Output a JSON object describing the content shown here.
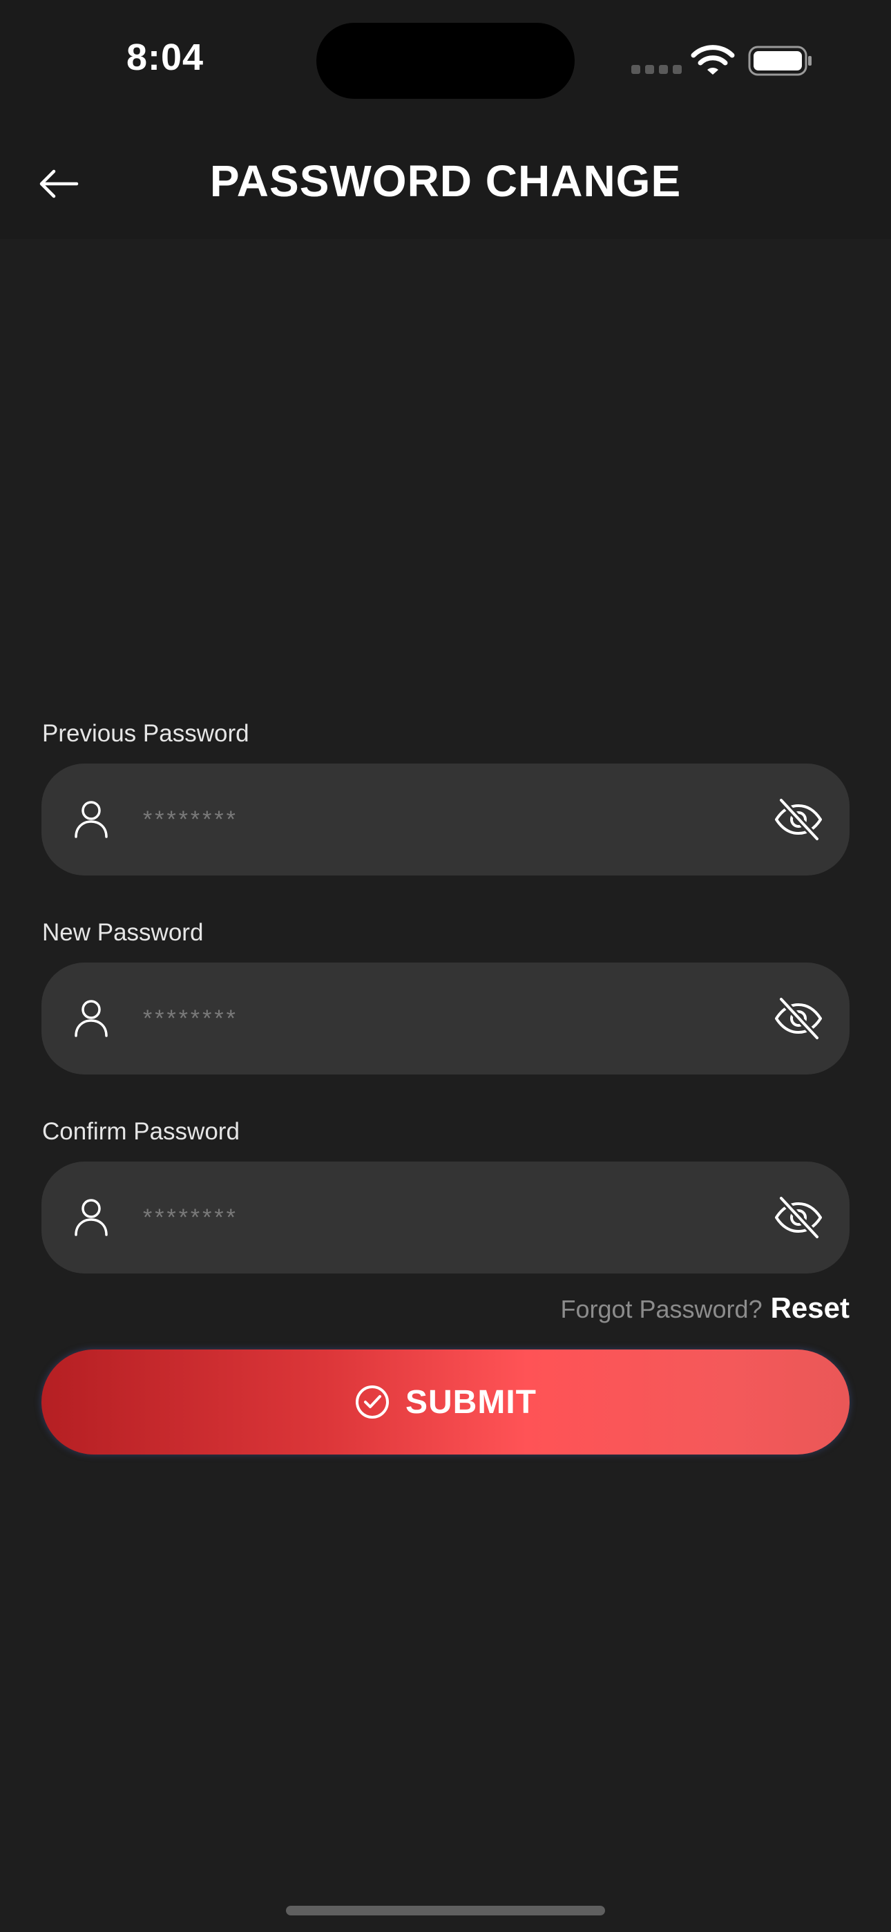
{
  "status_bar": {
    "time": "8:04"
  },
  "header": {
    "title": "PASSWORD CHANGE",
    "back_icon": "arrow-left-icon"
  },
  "form": {
    "fields": [
      {
        "label": "Previous Password",
        "placeholder": "********",
        "leading_icon": "user-icon",
        "trailing_icon": "eye-off-icon"
      },
      {
        "label": "New Password",
        "placeholder": "********",
        "leading_icon": "user-icon",
        "trailing_icon": "eye-off-icon"
      },
      {
        "label": "Confirm Password",
        "placeholder": "********",
        "leading_icon": "user-icon",
        "trailing_icon": "eye-off-icon"
      }
    ],
    "forgot_text": "Forgot Password?",
    "reset_label": "Reset",
    "submit_label": "SUBMIT",
    "submit_icon": "check-circle-icon"
  },
  "colors": {
    "background": "#1e1e1e",
    "field_background": "#343434",
    "accent_start": "#b51f23",
    "accent_end": "#ff5356"
  }
}
